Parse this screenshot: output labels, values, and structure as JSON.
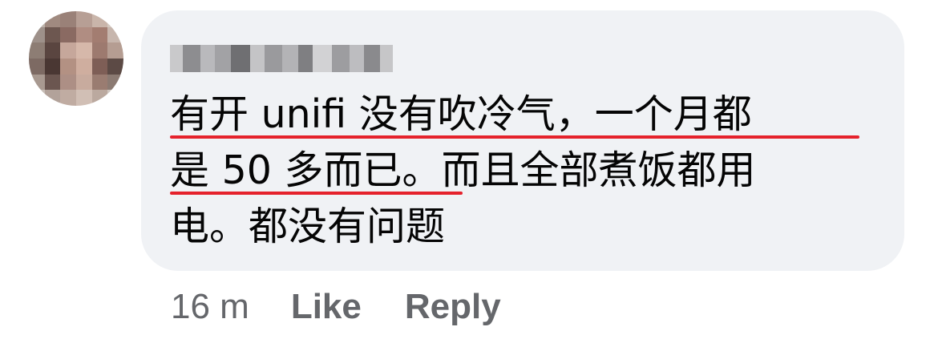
{
  "comment": {
    "author": "",
    "lines": [
      "有开 unifi 没有吹冷气，一个月都",
      "是 50 多而已。而且全部煮饭都用",
      "电。都没有问题"
    ],
    "underline_color": "#e5222c"
  },
  "meta": {
    "time": "16 m",
    "like_label": "Like",
    "reply_label": "Reply"
  },
  "colors": {
    "bubble": "#f0f2f5",
    "text": "#050505",
    "secondary": "#65676b"
  }
}
